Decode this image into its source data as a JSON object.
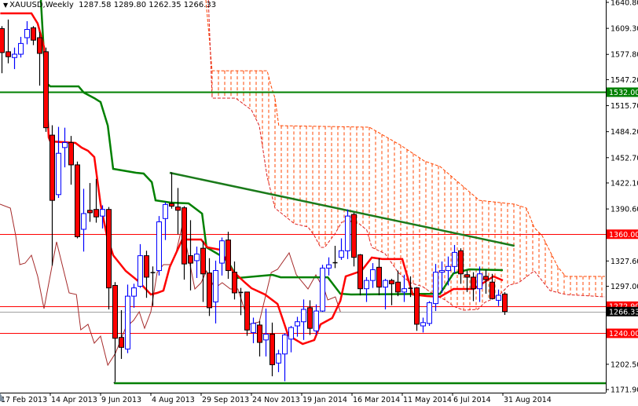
{
  "header": {
    "symbol": "XAUUSD,Weekly",
    "ohlc": "1287.58 1289.80 1262.35 1266.33",
    "menu_icon": "triangle-down-icon"
  },
  "colors": {
    "bull": "#0000ff",
    "bear": "#ff0000",
    "tenkan": "#ff0000",
    "kijun": "#008000",
    "chikou": "#a52a2a",
    "cloud": "#ff4500",
    "support_resistance": "#ff0000",
    "green_level": "#008000",
    "current_price": "#000000"
  },
  "chart_data": {
    "type": "candlestick",
    "title": "XAUUSD,Weekly",
    "ylim": [
      1171.9,
      1640.8
    ],
    "price_ticks": [
      "1640.80",
      "1609.30",
      "1577.80",
      "1547.20",
      "1515.70",
      "1484.20",
      "1452.70",
      "1422.10",
      "1390.60",
      "1327.60",
      "1297.00",
      "1202.50",
      "1171.90"
    ],
    "date_ticks": [
      {
        "week": 0,
        "label": "17 Feb 2013"
      },
      {
        "week": 8,
        "label": "14 Apr 2013"
      },
      {
        "week": 16,
        "label": "9 Jun 2013"
      },
      {
        "week": 24,
        "label": "4 Aug 2013"
      },
      {
        "week": 32,
        "label": "29 Sep 2013"
      },
      {
        "week": 40,
        "label": "24 Nov 2013"
      },
      {
        "week": 48,
        "label": "19 Jan 2014"
      },
      {
        "week": 56,
        "label": "16 Mar 2014"
      },
      {
        "week": 64,
        "label": "11 May 2014"
      },
      {
        "week": 72,
        "label": "6 Jul 2014"
      },
      {
        "week": 80,
        "label": "31 Aug 2014"
      }
    ],
    "candles_ohlc": [
      [
        1609,
        1612,
        1555,
        1580
      ],
      [
        1581,
        1620,
        1567,
        1575
      ],
      [
        1574,
        1586,
        1560,
        1578
      ],
      [
        1578,
        1599,
        1574,
        1591
      ],
      [
        1598,
        1618,
        1590,
        1608
      ],
      [
        1610,
        1612,
        1589,
        1595
      ],
      [
        1598,
        1605,
        1540,
        1579
      ],
      [
        1581,
        1586,
        1484,
        1489
      ],
      [
        1480,
        1492,
        1322,
        1401
      ],
      [
        1408,
        1490,
        1404,
        1458
      ],
      [
        1465,
        1489,
        1441,
        1471
      ],
      [
        1471,
        1479,
        1420,
        1444
      ],
      [
        1444,
        1448,
        1355,
        1357
      ],
      [
        1366,
        1415,
        1339,
        1385
      ],
      [
        1389,
        1422,
        1375,
        1386
      ],
      [
        1390,
        1427,
        1374,
        1381
      ],
      [
        1382,
        1395,
        1367,
        1390
      ],
      [
        1390,
        1393,
        1269,
        1295
      ],
      [
        1298,
        1302,
        1181,
        1234
      ],
      [
        1235,
        1268,
        1209,
        1223
      ],
      [
        1221,
        1299,
        1216,
        1285
      ],
      [
        1285,
        1300,
        1271,
        1295
      ],
      [
        1297,
        1348,
        1295,
        1334
      ],
      [
        1334,
        1340,
        1283,
        1308
      ],
      [
        1313,
        1321,
        1273,
        1313.5
      ],
      [
        1316,
        1382,
        1310,
        1375
      ],
      [
        1379,
        1399,
        1353,
        1396
      ],
      [
        1397,
        1435,
        1391,
        1394
      ],
      [
        1393,
        1416,
        1360,
        1389
      ],
      [
        1392,
        1394,
        1305,
        1324
      ],
      [
        1334,
        1377,
        1292,
        1325
      ],
      [
        1328,
        1345,
        1307,
        1336
      ],
      [
        1343,
        1352,
        1278,
        1312
      ],
      [
        1313,
        1331,
        1261,
        1271
      ],
      [
        1278,
        1328,
        1252,
        1316
      ],
      [
        1325,
        1356,
        1310,
        1352
      ],
      [
        1353,
        1363,
        1306,
        1316
      ],
      [
        1314,
        1327,
        1281,
        1289
      ],
      [
        1289,
        1295,
        1262,
        1289.5
      ],
      [
        1290,
        1290,
        1237,
        1244
      ],
      [
        1241,
        1259,
        1228,
        1252
      ],
      [
        1250,
        1255,
        1212,
        1229
      ],
      [
        1232,
        1270,
        1212,
        1239
      ],
      [
        1239,
        1253,
        1188,
        1202
      ],
      [
        1204,
        1220,
        1193,
        1215
      ],
      [
        1215,
        1240,
        1182,
        1238
      ],
      [
        1233,
        1249,
        1217,
        1247
      ],
      [
        1249,
        1260,
        1236,
        1254
      ],
      [
        1254,
        1281,
        1232,
        1269
      ],
      [
        1271,
        1280,
        1238,
        1246
      ],
      [
        1243,
        1275,
        1238,
        1267
      ],
      [
        1267,
        1323,
        1266,
        1319
      ],
      [
        1319,
        1332,
        1310,
        1323
      ],
      [
        1325,
        1346,
        1319,
        1325.5
      ],
      [
        1332,
        1355,
        1329,
        1340
      ],
      [
        1340,
        1390,
        1330,
        1382
      ],
      [
        1384,
        1386,
        1321,
        1332
      ],
      [
        1335,
        1336,
        1286,
        1294
      ],
      [
        1294,
        1308,
        1278,
        1304
      ],
      [
        1304,
        1325,
        1295,
        1317
      ],
      [
        1320,
        1331,
        1286,
        1296
      ],
      [
        1296,
        1306,
        1269,
        1304
      ],
      [
        1304,
        1306,
        1274,
        1300
      ],
      [
        1302,
        1316,
        1285,
        1290
      ],
      [
        1290,
        1311,
        1278,
        1294
      ],
      [
        1294,
        1309,
        1284,
        1294.5
      ],
      [
        1295,
        1296,
        1243,
        1251
      ],
      [
        1249,
        1259,
        1241,
        1253
      ],
      [
        1252,
        1279,
        1249,
        1277
      ],
      [
        1276,
        1324,
        1267,
        1314
      ],
      [
        1314,
        1327,
        1289,
        1316
      ],
      [
        1316,
        1333,
        1298,
        1321
      ],
      [
        1321,
        1347,
        1313,
        1338
      ],
      [
        1340,
        1343,
        1300,
        1312
      ],
      [
        1311,
        1316,
        1290,
        1308
      ],
      [
        1308,
        1314,
        1279,
        1294
      ],
      [
        1294,
        1321,
        1278,
        1312
      ],
      [
        1309,
        1317,
        1288,
        1305
      ],
      [
        1302,
        1312,
        1281,
        1282
      ],
      [
        1280,
        1293,
        1273,
        1286
      ],
      [
        1287.58,
        1289.8,
        1262.35,
        1266.33
      ]
    ],
    "indicators": {
      "tenkan": [
        [
          -0.2,
          1627.5
        ],
        [
          4.75,
          1627.5
        ],
        [
          5.75,
          1615.1
        ],
        [
          6.75,
          1586.6
        ],
        [
          7.5,
          1477.2
        ],
        [
          7.75,
          1472.5
        ],
        [
          11.75,
          1470.6
        ],
        [
          12.75,
          1464.9
        ],
        [
          13.75,
          1461.1
        ],
        [
          14.75,
          1453.5
        ],
        [
          15.75,
          1396.4
        ],
        [
          16.75,
          1358.4
        ],
        [
          17.75,
          1334.6
        ],
        [
          18.75,
          1325.1
        ],
        [
          19.75,
          1315.6
        ],
        [
          21.75,
          1303.2
        ],
        [
          23.75,
          1287.0
        ],
        [
          24.75,
          1288.9
        ],
        [
          25.75,
          1291.8
        ],
        [
          26.75,
          1320.3
        ],
        [
          28.75,
          1353.6
        ],
        [
          31.75,
          1353.6
        ],
        [
          32.75,
          1344.1
        ],
        [
          34.75,
          1341.2
        ],
        [
          36.75,
          1315.6
        ],
        [
          38.75,
          1301.3
        ],
        [
          39.75,
          1294.6
        ],
        [
          41.9,
          1287.0
        ],
        [
          43.9,
          1275.6
        ],
        [
          45.6,
          1237.6
        ],
        [
          47.9,
          1227.1
        ],
        [
          49.75,
          1231.9
        ],
        [
          50.75,
          1250.9
        ],
        [
          52.6,
          1258.5
        ],
        [
          53.9,
          1279.4
        ],
        [
          54.75,
          1308.9
        ],
        [
          57.25,
          1315.6
        ],
        [
          58.9,
          1331.7
        ],
        [
          60.6,
          1329.9
        ],
        [
          63.75,
          1329.9
        ],
        [
          65.4,
          1287.0
        ],
        [
          67.6,
          1285.1
        ],
        [
          69.75,
          1284.2
        ],
        [
          71.9,
          1293.7
        ],
        [
          75.1,
          1293.7
        ],
        [
          78.25,
          1308.9
        ],
        [
          79.75,
          1304.1
        ]
      ],
      "kijun": [
        [
          6.25,
          1643.7
        ],
        [
          7,
          1543.8
        ],
        [
          7.75,
          1539.0
        ],
        [
          12.25,
          1539.0
        ],
        [
          13.1,
          1531.4
        ],
        [
          14.75,
          1524.8
        ],
        [
          15.75,
          1520.0
        ],
        [
          16.9,
          1491.5
        ],
        [
          17.75,
          1439.2
        ],
        [
          21.4,
          1434.4
        ],
        [
          22.6,
          1433.5
        ],
        [
          23.9,
          1423.0
        ],
        [
          24.5,
          1401.1
        ],
        [
          26.9,
          1398.3
        ],
        [
          29.75,
          1397.3
        ],
        [
          31.9,
          1385.0
        ],
        [
          32.6,
          1344.1
        ],
        [
          34.75,
          1334.6
        ],
        [
          36,
          1327.0
        ],
        [
          37.25,
          1310.8
        ],
        [
          37.6,
          1307.0
        ],
        [
          43.1,
          1310.8
        ],
        [
          44.4,
          1307.9
        ],
        [
          51.9,
          1307.9
        ],
        [
          53.9,
          1287.9
        ],
        [
          55.6,
          1287.0
        ],
        [
          69.75,
          1287.9
        ],
        [
          71.9,
          1312.7
        ],
        [
          74.4,
          1317.5
        ],
        [
          79.75,
          1316.5
        ]
      ],
      "chikou": [
        [
          -0.25,
          1396.4
        ],
        [
          1.4,
          1391.6
        ],
        [
          2.25,
          1358.4
        ],
        [
          2.9,
          1323.2
        ],
        [
          3.75,
          1325.1
        ],
        [
          4.75,
          1334.6
        ],
        [
          5.75,
          1308.9
        ],
        [
          6.75,
          1269.9
        ],
        [
          8.75,
          1350.7
        ],
        [
          10.75,
          1288.9
        ],
        [
          11.9,
          1287.0
        ],
        [
          12.6,
          1244.2
        ],
        [
          13.75,
          1250.9
        ],
        [
          14.75,
          1228.1
        ],
        [
          15.75,
          1236.6
        ],
        [
          16.9,
          1201.4
        ],
        [
          18.1,
          1215.7
        ],
        [
          19.75,
          1247.1
        ],
        [
          21,
          1255.6
        ],
        [
          21.9,
          1266.1
        ],
        [
          22.75,
          1246.1
        ],
        [
          23.75,
          1266.1
        ],
        [
          24.75,
          1313.7
        ],
        [
          25.75,
          1323.2
        ],
        [
          26.9,
          1323.2
        ],
        [
          27.75,
          1337.4
        ],
        [
          28.75,
          1370.7
        ],
        [
          29.4,
          1346.0
        ],
        [
          30.75,
          1293.7
        ],
        [
          31.75,
          1301.3
        ],
        [
          32.6,
          1315.6
        ],
        [
          33.9,
          1294.6
        ],
        [
          35.1,
          1301.3
        ],
        [
          36.4,
          1293.7
        ],
        [
          37.6,
          1293.7
        ],
        [
          39.4,
          1250.9
        ],
        [
          41,
          1253.7
        ],
        [
          42.9,
          1313.7
        ],
        [
          43.9,
          1317.5
        ],
        [
          45.75,
          1337.4
        ],
        [
          46.9,
          1310.8
        ],
        [
          48.75,
          1293.7
        ],
        [
          50,
          1310.8
        ],
        [
          51.4,
          1291.8
        ],
        [
          51.9,
          1280.4
        ],
        [
          53.1,
          1284.2
        ],
        [
          53.9,
          1266.1
        ]
      ],
      "cloud_upper": [
        [
          32.5,
          1643.7
        ],
        [
          33.5,
          1558.0
        ],
        [
          42.25,
          1558.0
        ],
        [
          42.9,
          1539.0
        ],
        [
          43.5,
          1524.8
        ],
        [
          44.1,
          1491.5
        ],
        [
          58.5,
          1489.6
        ],
        [
          63.5,
          1467.7
        ],
        [
          67.25,
          1448.7
        ],
        [
          69.75,
          1442.0
        ],
        [
          76,
          1401.1
        ],
        [
          81.6,
          1396.4
        ],
        [
          83.5,
          1391.6
        ],
        [
          84.75,
          1367.9
        ],
        [
          86,
          1358.4
        ],
        [
          88.5,
          1320.3
        ],
        [
          89.75,
          1308.9
        ],
        [
          96,
          1308.9
        ]
      ],
      "cloud_lower": [
        [
          32.9,
          1643.7
        ],
        [
          33.5,
          1524.8
        ],
        [
          37.25,
          1524.8
        ],
        [
          39.75,
          1510.5
        ],
        [
          41,
          1491.5
        ],
        [
          42.25,
          1429.7
        ],
        [
          43.5,
          1391.6
        ],
        [
          44.75,
          1384.0
        ],
        [
          46.6,
          1372.6
        ],
        [
          48.75,
          1368.8
        ],
        [
          49.75,
          1358.4
        ],
        [
          50.75,
          1344.1
        ],
        [
          51.4,
          1344.1
        ],
        [
          53.1,
          1361.2
        ],
        [
          54.1,
          1374.5
        ],
        [
          55.75,
          1375.5
        ],
        [
          56.9,
          1372.6
        ],
        [
          58.1,
          1365.0
        ],
        [
          58.9,
          1344.1
        ],
        [
          61,
          1336.5
        ],
        [
          62.25,
          1323.2
        ],
        [
          63.1,
          1313.7
        ],
        [
          65,
          1301.3
        ],
        [
          67,
          1296.5
        ],
        [
          68.75,
          1287.0
        ],
        [
          70.6,
          1280.4
        ],
        [
          71.9,
          1272.8
        ],
        [
          73.5,
          1268.0
        ],
        [
          75.75,
          1269.0
        ],
        [
          76.9,
          1277.5
        ],
        [
          78.9,
          1284.2
        ],
        [
          80.75,
          1298.4
        ],
        [
          82.25,
          1301.3
        ],
        [
          84.75,
          1315.6
        ],
        [
          87.25,
          1291.8
        ],
        [
          89.75,
          1287.0
        ],
        [
          96,
          1284.2
        ]
      ]
    },
    "trendline": [
      [
        26.75,
        1434.4
      ],
      [
        81.6,
        1346.0
      ]
    ],
    "support_line": {
      "from_week": 17.9,
      "price": 1179.6
    },
    "levels": [
      {
        "price": 1532.0,
        "label": "1532.00",
        "color": "#008000",
        "name": "level-1532"
      },
      {
        "price": 1360.0,
        "label": "1360.00",
        "color": "#ff0000",
        "name": "level-1360"
      },
      {
        "price": 1272.9,
        "label": "1272.90",
        "color": "#ff0000",
        "name": "level-1272"
      },
      {
        "price": 1240.0,
        "label": "1240.00",
        "color": "#ff0000",
        "name": "level-1240"
      },
      {
        "price": 1266.33,
        "label": "1266.33",
        "color": "#000000",
        "name": "current-price",
        "line": "#a0a0a0"
      }
    ]
  }
}
